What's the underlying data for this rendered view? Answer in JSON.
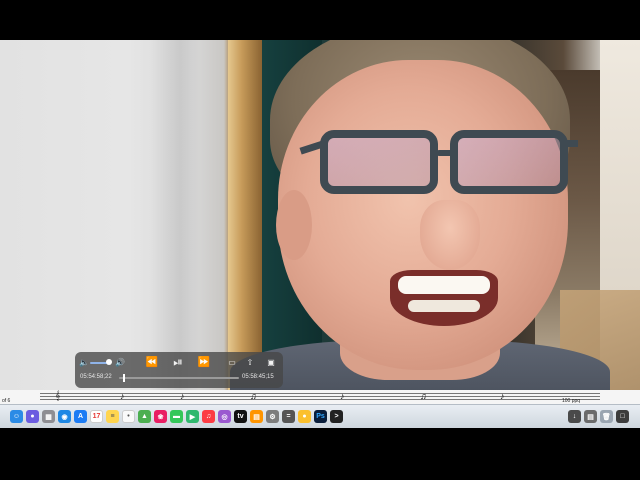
{
  "player": {
    "current_time": "05:54:58;22",
    "remaining_time": "05:58:45;15",
    "progress": 0.03,
    "volume": 0.9,
    "icons": [
      "volume-low-icon",
      "volume-high-icon",
      "rewind-icon",
      "play-pause-icon",
      "fast-forward-icon",
      "airplay-icon",
      "share-icon",
      "picture-in-picture-icon"
    ]
  },
  "score": {
    "left_text": "of 6",
    "tempo_text": "100 ppq"
  },
  "dock": {
    "apps": [
      "finder",
      "siri",
      "launchpad",
      "safari",
      "app-store",
      "calendar",
      "notes",
      "reminders",
      "maps",
      "photos",
      "messages",
      "facetime",
      "music",
      "podcasts",
      "tv",
      "books",
      "system-preferences",
      "calculator",
      "chrome",
      "photoshop",
      "terminal",
      "trash"
    ],
    "badge_text": "Ps"
  },
  "colors": {
    "accent": "#8fb3e8",
    "player_bg": "#464646"
  }
}
